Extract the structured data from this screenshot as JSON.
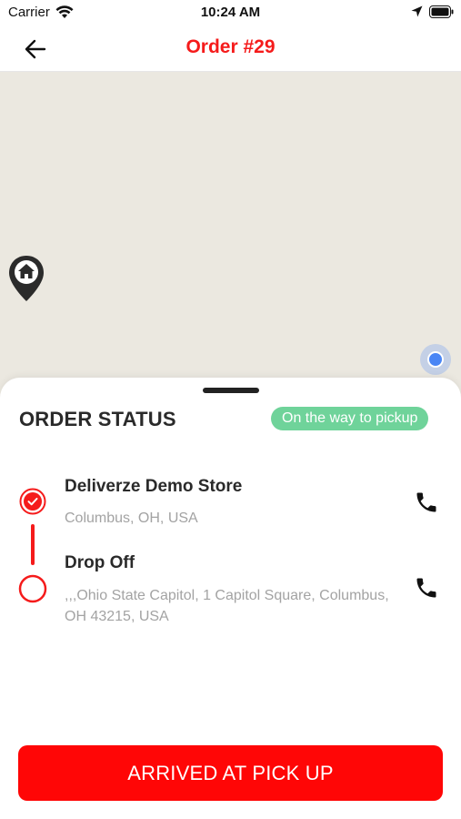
{
  "status_bar": {
    "carrier": "Carrier",
    "time": "10:24 AM",
    "icons": [
      "wifi-icon",
      "location-arrow-icon",
      "battery-icon"
    ]
  },
  "nav": {
    "title": "Order #29",
    "back_icon": "arrow-left-icon"
  },
  "map": {
    "markers": [
      "home-marker-icon",
      "current-location-dot"
    ]
  },
  "sheet": {
    "title": "ORDER STATUS",
    "status_badge": "On the way to pickup",
    "stops": [
      {
        "name": "Deliverze Demo Store",
        "address": "Columbus, OH, USA",
        "state_icon": "check-circle-icon",
        "action_icon": "phone-icon"
      },
      {
        "name": "Drop Off",
        "address": ",,,Ohio State Capitol, 1 Capitol Square, Columbus, OH 43215, USA",
        "state_icon": "empty-circle-icon",
        "action_icon": "phone-icon"
      }
    ],
    "action_button": "ARRIVED AT PICK UP"
  },
  "colors": {
    "accent": "#f51b1b",
    "button": "#ff0606",
    "badge": "#6fd39a",
    "map_background": "#ebe8e0",
    "location_dot": "#4a86f5",
    "secondary_text": "#a3a3a3"
  }
}
